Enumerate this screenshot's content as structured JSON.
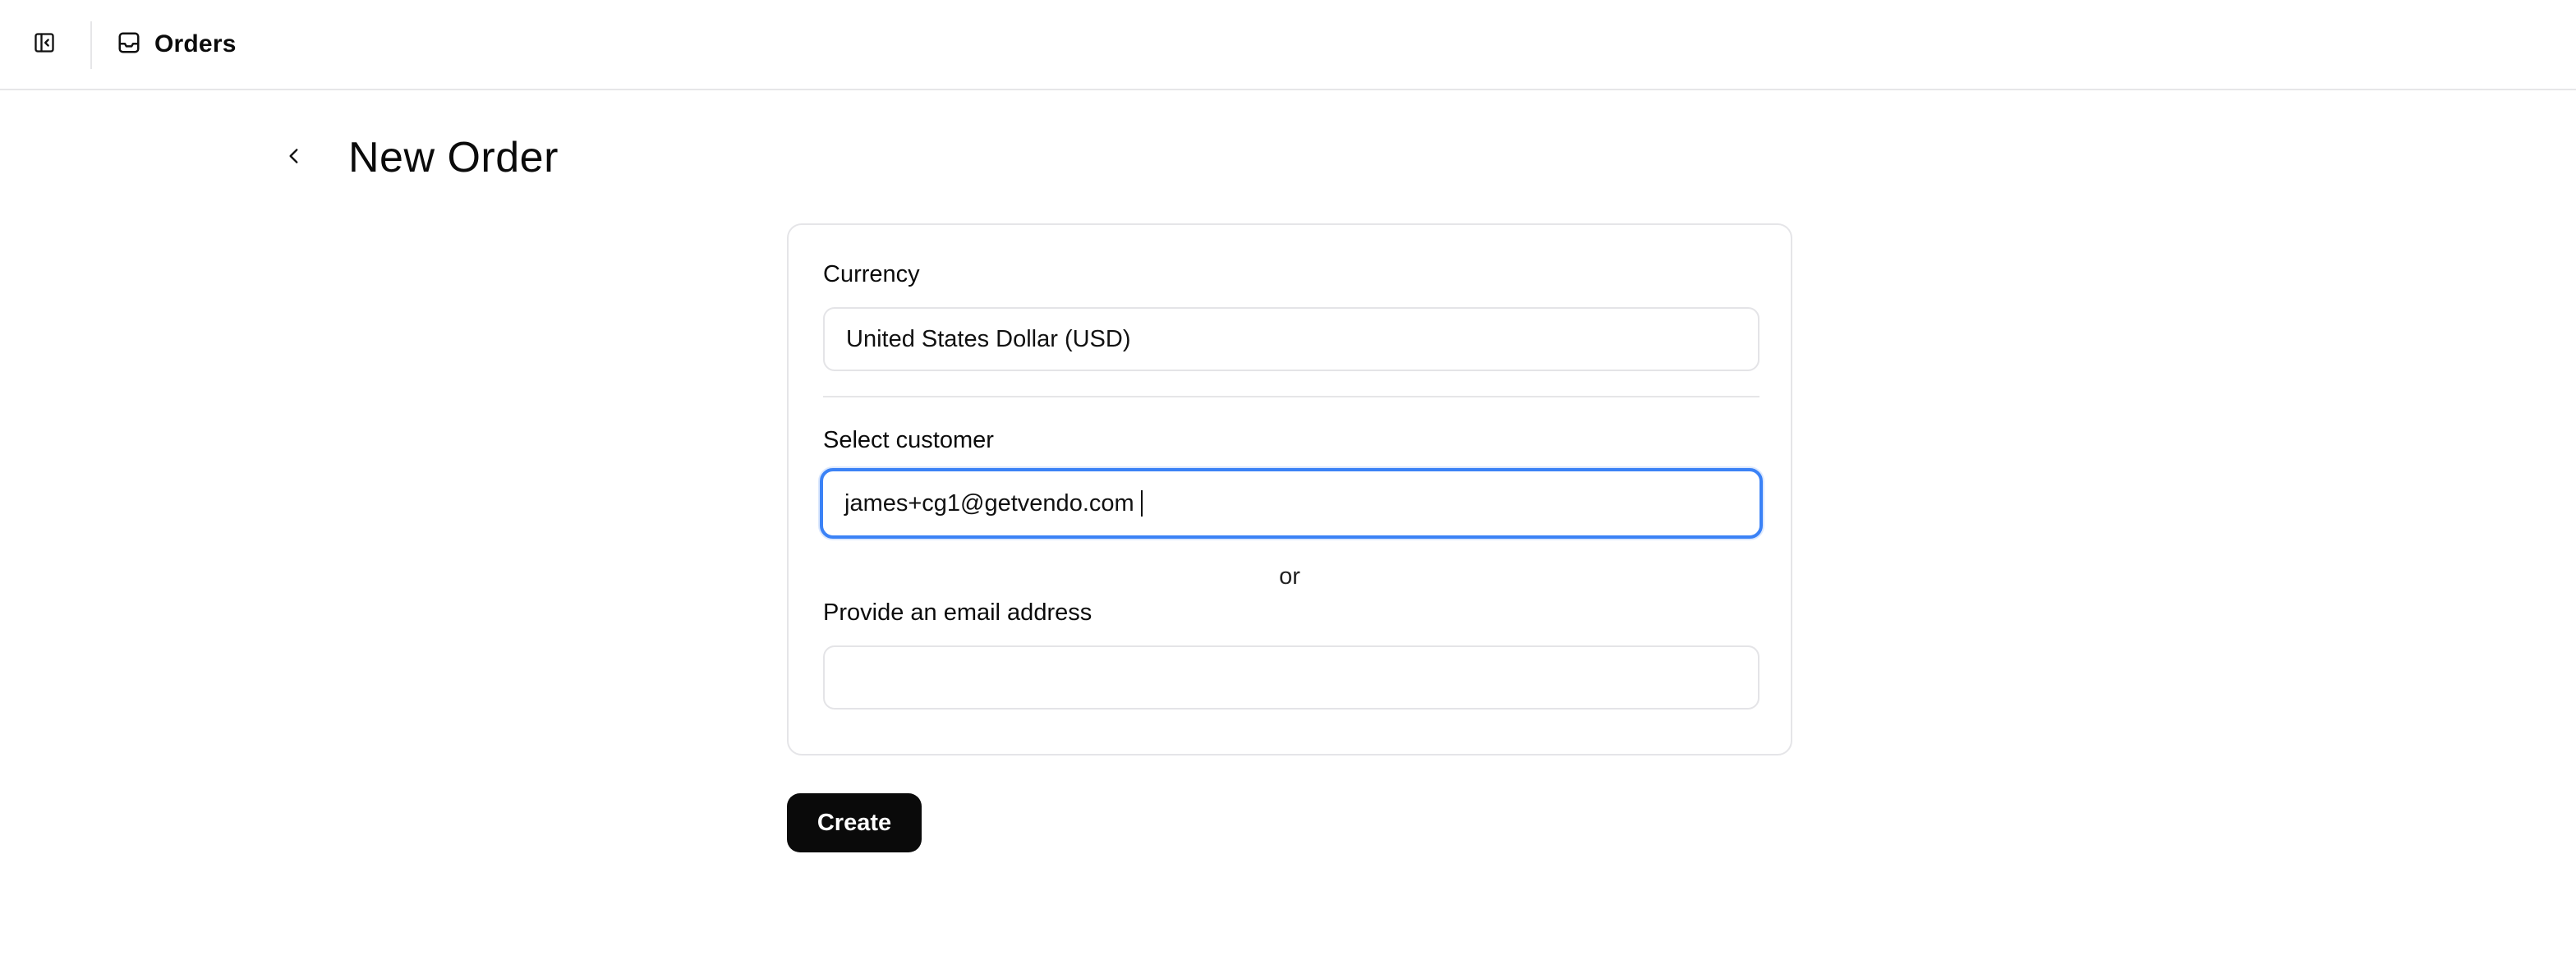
{
  "header": {
    "sidebar_toggle_icon": "sidebar-panel-icon",
    "breadcrumb": {
      "icon": "inbox-icon",
      "label": "Orders"
    }
  },
  "page": {
    "back_icon": "chevron-left-icon",
    "title": "New Order"
  },
  "form": {
    "currency": {
      "label": "Currency",
      "value": "United States Dollar (USD)"
    },
    "customer": {
      "label": "Select customer",
      "value": "james+cg1@getvendo.com"
    },
    "separator": "or",
    "email": {
      "label": "Provide an email address",
      "value": ""
    },
    "submit_label": "Create"
  },
  "colors": {
    "focus_ring": "#3b82f6",
    "primary_button": "#0a0a0a",
    "border": "#e4e4e7"
  }
}
